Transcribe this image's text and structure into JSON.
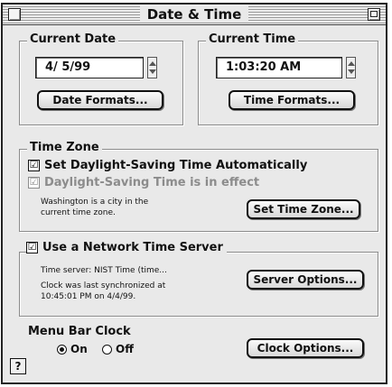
{
  "window": {
    "title": "Date & Time"
  },
  "current_date": {
    "group_label": "Current Date",
    "value": "4/ 5/99",
    "button_label": "Date Formats..."
  },
  "current_time": {
    "group_label": "Current Time",
    "value": "1:03:20 AM",
    "button_label": "Time Formats..."
  },
  "time_zone": {
    "group_label": "Time Zone",
    "dst_auto_label": "Set Daylight-Saving Time Automatically",
    "dst_auto_checked": true,
    "dst_effect_label": "Daylight-Saving Time is in effect",
    "dst_effect_checked": true,
    "info_line1": "Washington is a city in the",
    "info_line2": "current time zone.",
    "button_label": "Set Time Zone..."
  },
  "network_time": {
    "checkbox_label": "Use a Network Time Server",
    "checked": true,
    "server_text": "Time server: NIST Time (time...",
    "sync_line1": "Clock was last synchronized at",
    "sync_line2": "10:45:01 PM on 4/4/99.",
    "button_label": "Server Options..."
  },
  "menu_bar_clock": {
    "label": "Menu Bar Clock",
    "on_label": "On",
    "off_label": "Off",
    "selected": "On",
    "button_label": "Clock Options..."
  },
  "help": {
    "glyph": "?"
  },
  "check_glyph": "☑"
}
